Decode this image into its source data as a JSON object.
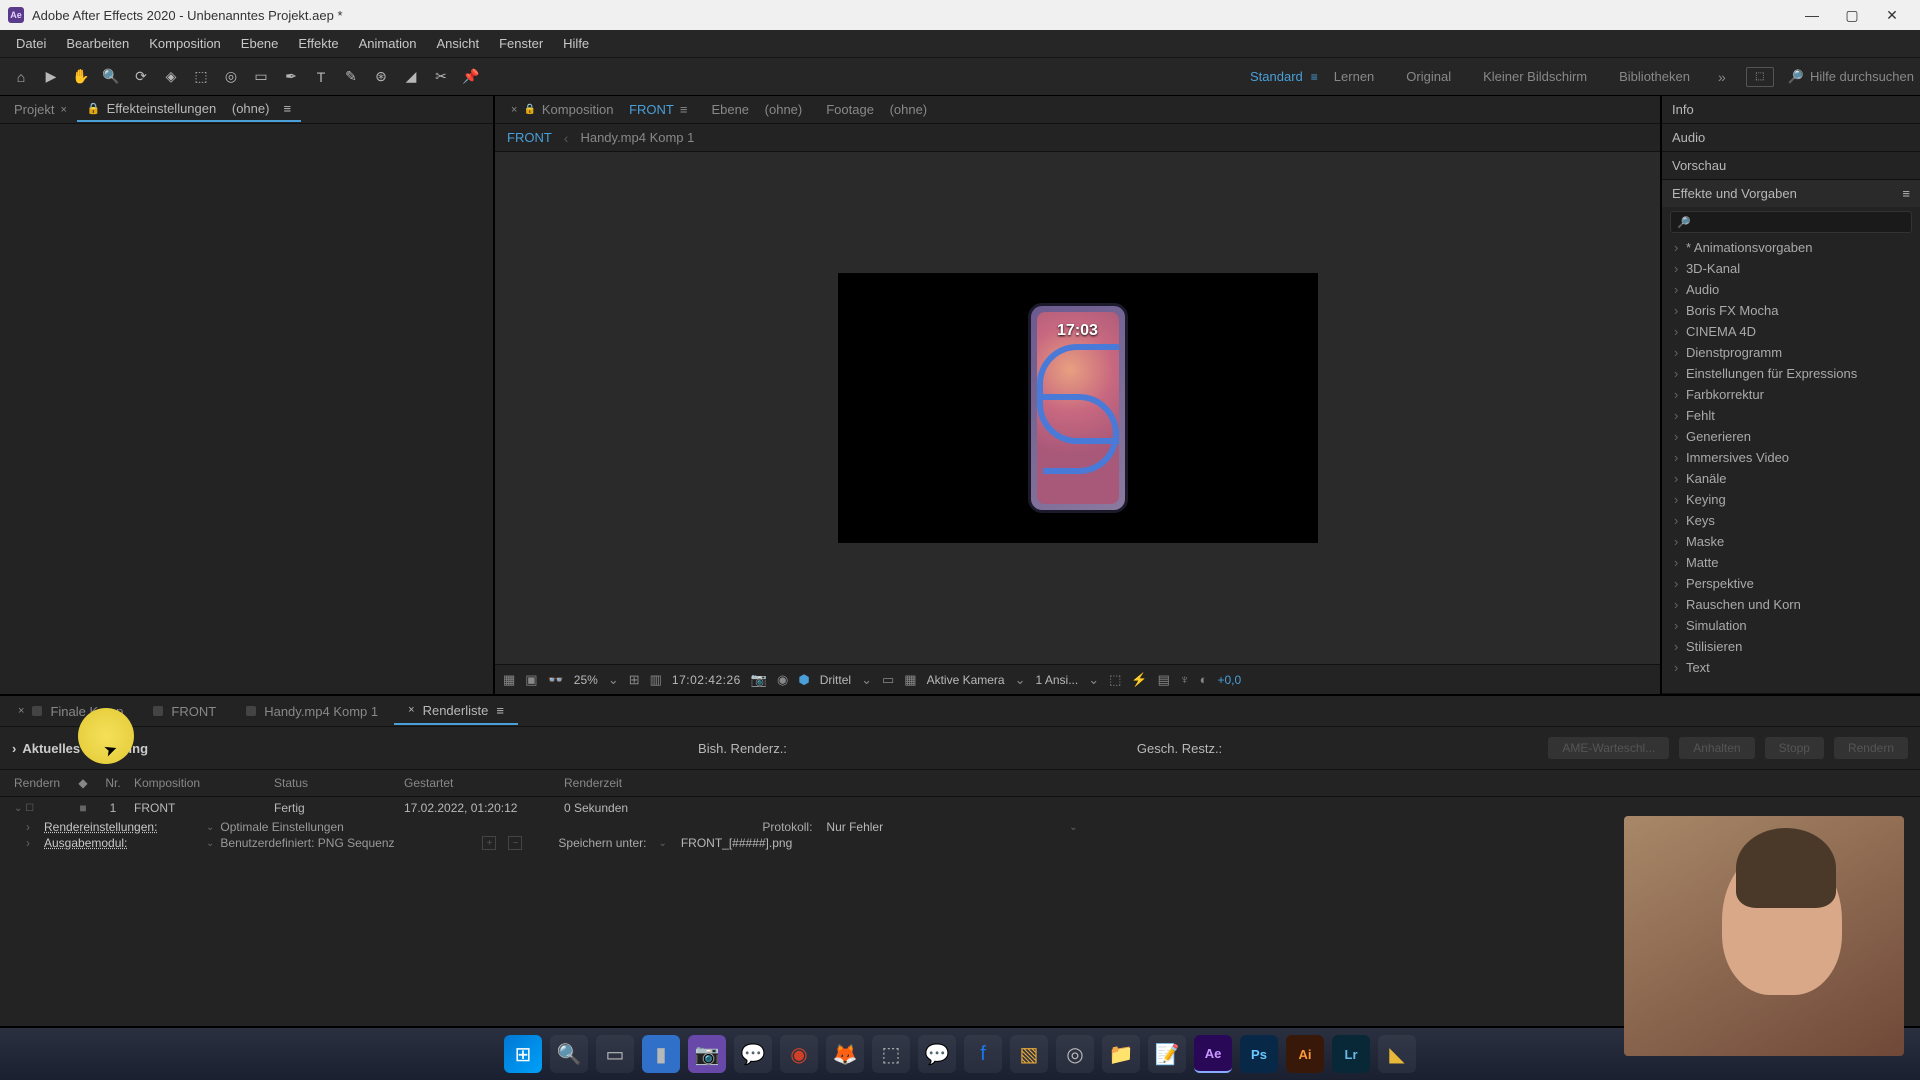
{
  "title_bar": {
    "app_icon_text": "Ae",
    "title": "Adobe After Effects 2020 - Unbenanntes Projekt.aep *"
  },
  "menu": [
    "Datei",
    "Bearbeiten",
    "Komposition",
    "Ebene",
    "Effekte",
    "Animation",
    "Ansicht",
    "Fenster",
    "Hilfe"
  ],
  "workspaces": {
    "active": "Standard",
    "items": [
      "Standard",
      "Lernen",
      "Original",
      "Kleiner Bildschirm",
      "Bibliotheken"
    ],
    "search_placeholder": "Hilfe durchsuchen"
  },
  "left_panel": {
    "tabs": [
      {
        "label": "Projekt",
        "active": false
      },
      {
        "label": "Effekteinstellungen",
        "suffix": "(ohne)",
        "active": true
      }
    ]
  },
  "comp_panel": {
    "tabs": [
      {
        "prefix": "Komposition",
        "name": "FRONT",
        "active": true
      },
      {
        "prefix": "Ebene",
        "name": "(ohne)",
        "active": false
      },
      {
        "prefix": "Footage",
        "name": "(ohne)",
        "active": false
      }
    ],
    "breadcrumb": [
      "FRONT",
      "Handy.mp4 Komp 1"
    ],
    "phone_time": "17:03",
    "controls": {
      "zoom": "25%",
      "timecode": "17:02:42:26",
      "resolution": "Drittel",
      "camera": "Aktive Kamera",
      "view_count": "1 Ansi...",
      "exposure": "+0,0"
    }
  },
  "right_panel": {
    "sections": [
      "Info",
      "Audio",
      "Vorschau"
    ],
    "effects_label": "Effekte und Vorgaben",
    "effects_items": [
      "* Animationsvorgaben",
      "3D-Kanal",
      "Audio",
      "Boris FX Mocha",
      "CINEMA 4D",
      "Dienstprogramm",
      "Einstellungen für Expressions",
      "Farbkorrektur",
      "Fehlt",
      "Generieren",
      "Immersives Video",
      "Kanäle",
      "Keying",
      "Keys",
      "Maske",
      "Matte",
      "Perspektive",
      "Rauschen und Korn",
      "Simulation",
      "Stilisieren",
      "Text"
    ]
  },
  "bottom_panel": {
    "tabs": [
      {
        "label": "Finale Komp"
      },
      {
        "label": "FRONT"
      },
      {
        "label": "Handy.mp4 Komp 1"
      },
      {
        "label": "Renderliste",
        "active": true
      }
    ],
    "render_header": {
      "current": "Aktuelles Rendering",
      "previous": "Bish. Renderz.:",
      "remaining": "Gesch. Restz.:",
      "buttons": [
        "AME-Warteschl...",
        "Anhalten",
        "Stopp",
        "Rendern"
      ]
    },
    "columns": {
      "render": "Rendern",
      "tag": "◆",
      "nr": "Nr.",
      "comp": "Komposition",
      "status": "Status",
      "started": "Gestartet",
      "rtime": "Renderzeit"
    },
    "row": {
      "checked": "✓",
      "tag": "■",
      "nr": "1",
      "comp": "FRONT",
      "status": "Fertig",
      "started": "17.02.2022, 01:20:12",
      "rtime": "0 Sekunden"
    },
    "sub1": {
      "label": "Rendereinstellungen:",
      "value": "Optimale Einstellungen",
      "proto_label": "Protokoll:",
      "proto_value": "Nur Fehler"
    },
    "sub2": {
      "label": "Ausgabemodul:",
      "value": "Benutzerdefiniert: PNG Sequenz",
      "save_label": "Speichern unter:",
      "save_value": "FRONT_[#####].png"
    }
  }
}
